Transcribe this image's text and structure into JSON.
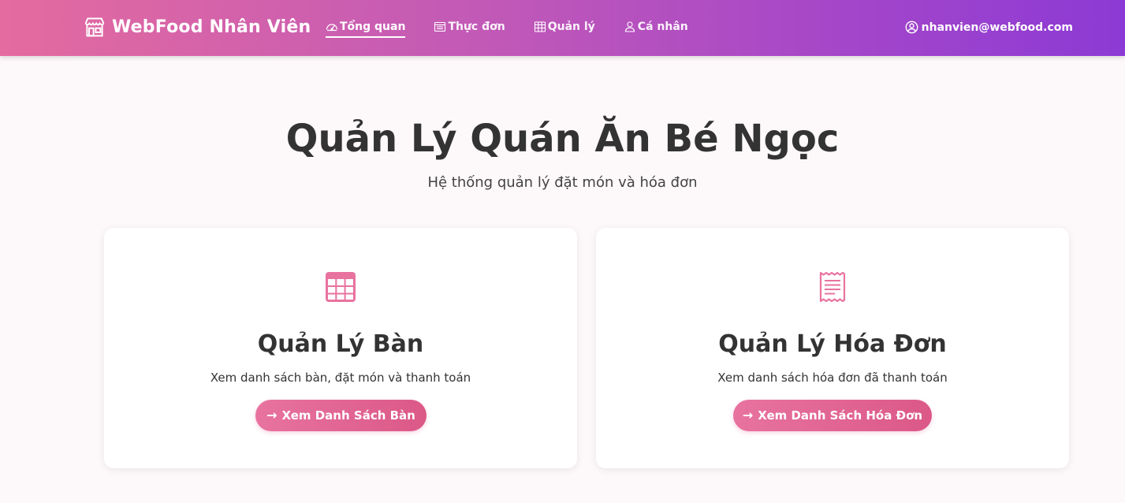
{
  "navbar": {
    "brand": {
      "icon": "shop-icon",
      "label": "WebFood Nhân Viên"
    },
    "links": [
      {
        "label": "Tổng quan",
        "icon": "speedometer-icon",
        "active": true
      },
      {
        "label": "Thực đơn",
        "icon": "menu-list-icon",
        "active": false
      },
      {
        "label": "Quản lý",
        "icon": "table-grid-icon",
        "active": false
      },
      {
        "label": "Cá nhân",
        "icon": "person-icon",
        "active": false
      }
    ],
    "user": {
      "icon": "user-circle-icon",
      "email": "nhanvien@webfood.com"
    }
  },
  "hero": {
    "title": "Quản Lý Quán Ăn Bé Ngọc",
    "subtitle": "Hệ thống quản lý đặt món và hóa đơn"
  },
  "cards": [
    {
      "icon": "table-grid-icon",
      "title": "Quản Lý Bàn",
      "description": "Xem danh sách bàn, đặt món và thanh toán",
      "button": {
        "arrow": "→",
        "label": "Xem Danh Sách Bàn"
      }
    },
    {
      "icon": "receipt-icon",
      "title": "Quản Lý Hóa Đơn",
      "description": "Xem danh sách hóa đơn đã thanh toán",
      "button": {
        "arrow": "→",
        "label": "Xem Danh Sách Hóa Đơn"
      }
    }
  ],
  "colors": {
    "accent": "#e46b9f",
    "navbar_gradient_start": "#e46b9f",
    "navbar_gradient_end": "#8c3ad5",
    "button_gradient_start": "#e8739f",
    "button_gradient_end": "#db5887",
    "text_dark": "#333333",
    "background": "#fdf8f9"
  }
}
